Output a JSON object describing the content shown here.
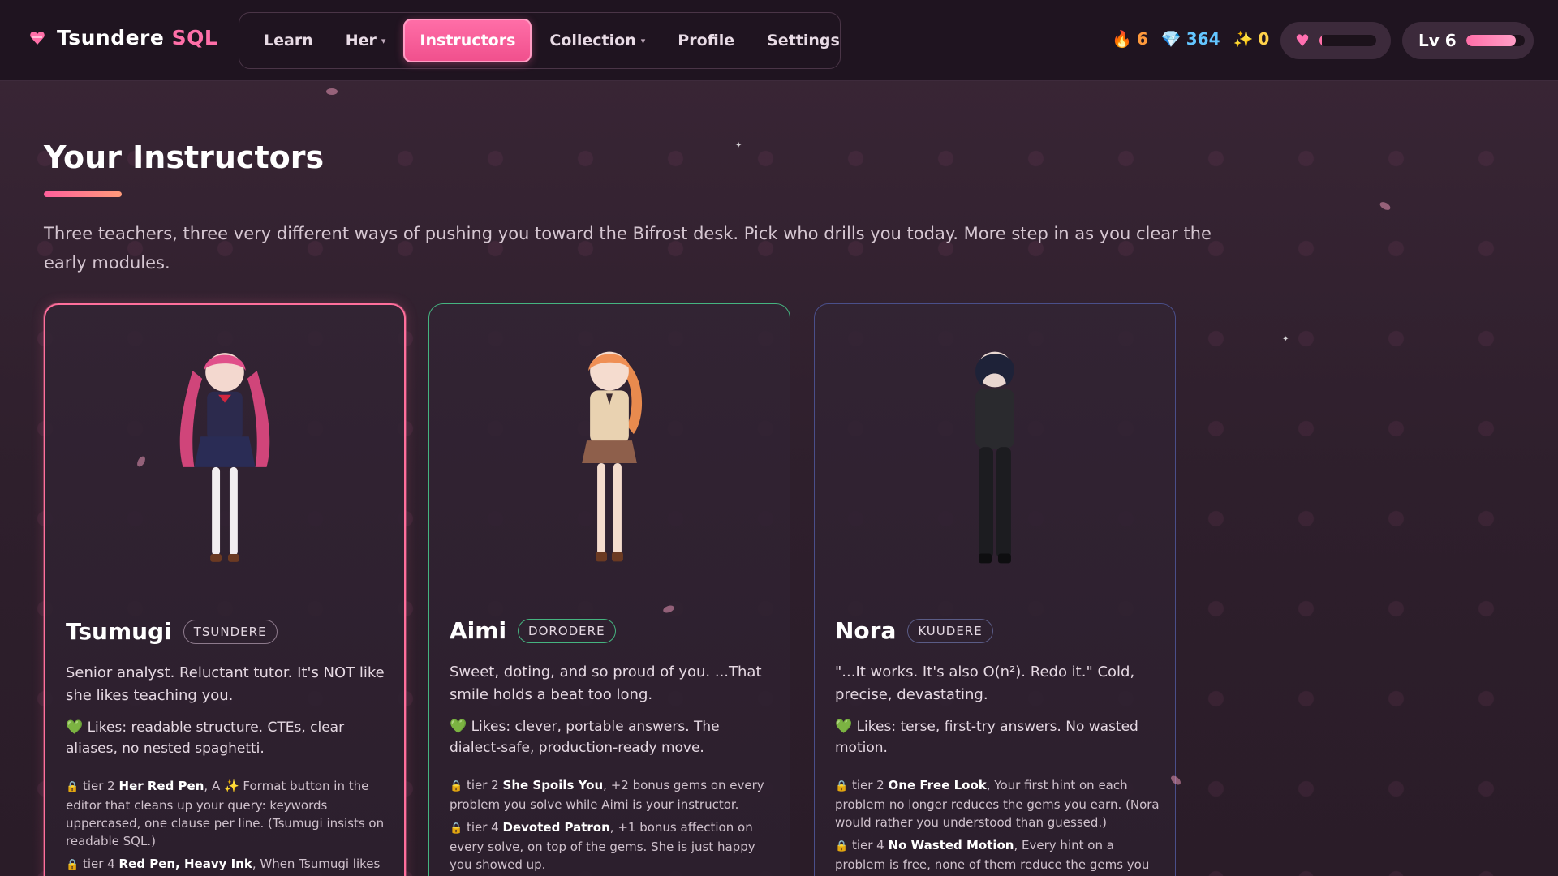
{
  "brand": {
    "name": "Tsundere",
    "accent": "SQL",
    "icon": "heart-logo-icon"
  },
  "nav": {
    "items": [
      {
        "label": "Learn",
        "has_caret": false
      },
      {
        "label": "Her",
        "has_caret": true
      },
      {
        "label": "Instructors",
        "has_caret": false,
        "active": true
      },
      {
        "label": "Collection",
        "has_caret": true
      },
      {
        "label": "Profile",
        "has_caret": false
      },
      {
        "label": "Settings",
        "has_caret": false
      }
    ]
  },
  "stats": {
    "streak": "6",
    "gems": "364",
    "sparkles": "0"
  },
  "affection": {
    "fill": 0.05
  },
  "level": {
    "label": "Lv 6",
    "fill": 0.85
  },
  "page": {
    "title": "Your Instructors",
    "subtitle": "Three teachers, three very different ways of pushing you toward the Bifrost desk. Pick who drills you today. More step in as you clear the early modules."
  },
  "instructors": [
    {
      "name": "Tsumugi",
      "archetype": "TSUNDERE",
      "tagline": "Senior analyst. Reluctant tutor. It's NOT like she likes teaching you.",
      "likes": "Likes: readable structure. CTEs, clear aliases, no nested spaghetti.",
      "perks": [
        {
          "tier": "tier 2",
          "name": "Her Red Pen",
          "desc": ", A ✨ Format button in the editor that cleans up your query: keywords uppercased, one clause per line. (Tsumugi insists on readable SQL.)"
        },
        {
          "tier": "tier 4",
          "name": "Red Pen, Heavy Ink",
          "desc": ", When Tsumugi likes"
        }
      ],
      "colors": {
        "border": "#ff6f9c"
      }
    },
    {
      "name": "Aimi",
      "archetype": "DORODERE",
      "tagline": "Sweet, doting, and so proud of you. ...That smile holds a beat too long.",
      "likes": "Likes: clever, portable answers. The dialect-safe, production-ready move.",
      "perks": [
        {
          "tier": "tier 2",
          "name": "She Spoils You",
          "desc": ", +2 bonus gems on every problem you solve while Aimi is your instructor."
        },
        {
          "tier": "tier 4",
          "name": "Devoted Patron",
          "desc": ", +1 bonus affection on every solve, on top of the gems. She is just happy you showed up."
        }
      ],
      "colors": {
        "border": "#45b480"
      }
    },
    {
      "name": "Nora",
      "archetype": "KUUDERE",
      "tagline": "\"...It works. It's also O(n²). Redo it.\" Cold, precise, devastating.",
      "likes": "Likes: terse, first-try answers. No wasted motion.",
      "perks": [
        {
          "tier": "tier 2",
          "name": "One Free Look",
          "desc": ", Your first hint on each problem no longer reduces the gems you earn. (Nora would rather you understood than guessed.)"
        },
        {
          "tier": "tier 4",
          "name": "No Wasted Motion",
          "desc": ", Every hint on a problem is free, none of them reduce the gems you earn."
        }
      ],
      "colors": {
        "border": "#4a4f8a"
      }
    }
  ],
  "icons": {
    "streak": "fire-icon",
    "gems": "gem-icon",
    "sparkles": "sparkle-icon",
    "affection": "heart-icon",
    "likes": "green-heart-icon",
    "perk": "lock-icon"
  }
}
